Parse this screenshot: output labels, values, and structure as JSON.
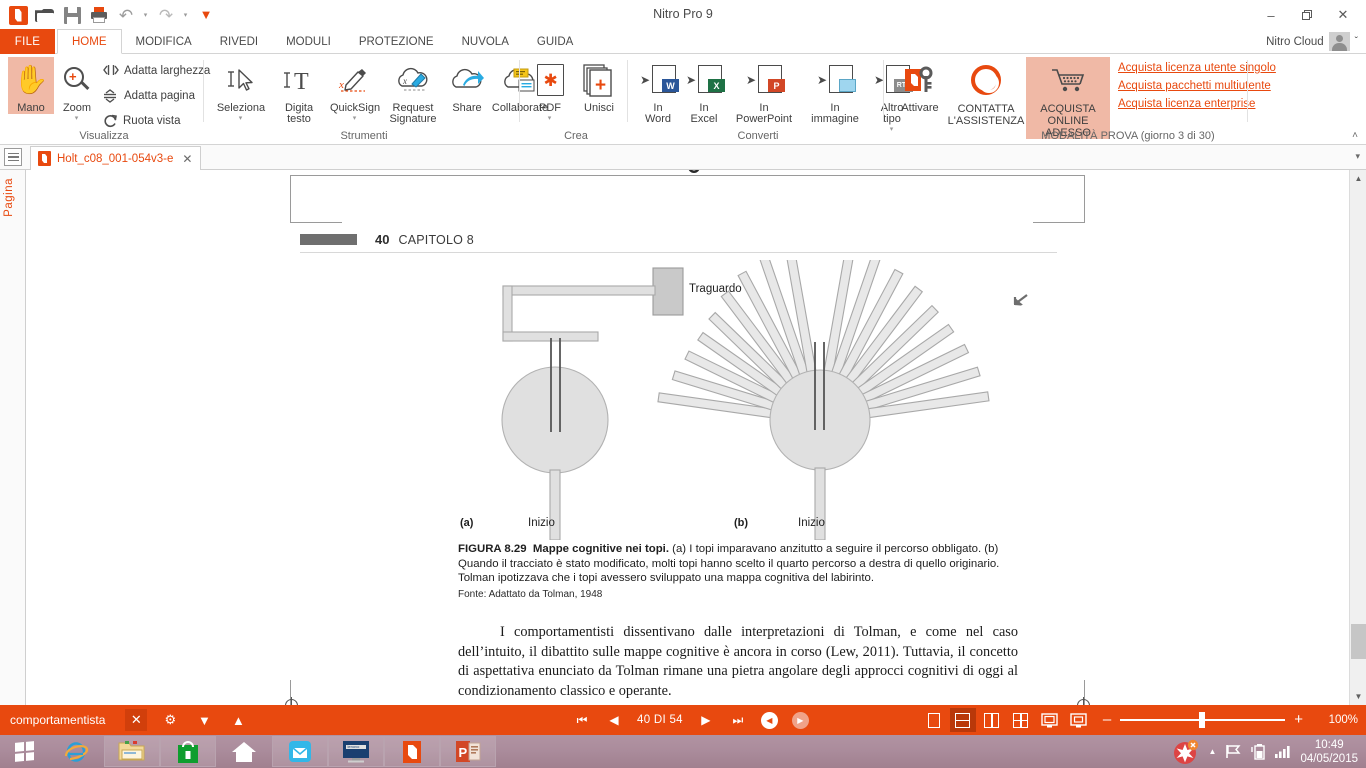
{
  "window": {
    "title": "Nitro Pro 9",
    "minimize": "–",
    "restore": "❐",
    "close": "✕"
  },
  "quick_access": {
    "items": [
      {
        "name": "nitro-app-icon",
        "label": "Nitro"
      },
      {
        "name": "open-icon",
        "label": "Apri"
      },
      {
        "name": "save-icon",
        "label": "Salva"
      },
      {
        "name": "print-icon",
        "label": "Stampa"
      },
      {
        "name": "undo-icon",
        "label": "Annulla"
      },
      {
        "name": "redo-icon",
        "label": "Ripristina"
      },
      {
        "name": "customize-qat-icon",
        "label": "Altro"
      }
    ]
  },
  "ribbon_tabs": {
    "file": "FILE",
    "items": [
      "HOME",
      "MODIFICA",
      "RIVEDI",
      "MODULI",
      "PROTEZIONE",
      "NUVOLA",
      "GUIDA"
    ],
    "active": "HOME"
  },
  "account": {
    "label": "Nitro Cloud",
    "chevron": "ˇ"
  },
  "ribbon": {
    "groups": [
      {
        "name": "visualizza",
        "label": "Visualizza",
        "buttons": [
          {
            "label": "Mano",
            "icon": "hand-icon",
            "active": true
          },
          {
            "label": "Zoom",
            "icon": "zoom-icon",
            "caret": "▾"
          }
        ],
        "small_items": [
          {
            "label": "Adatta larghezza",
            "icon": "fit-width-icon"
          },
          {
            "label": "Adatta pagina",
            "icon": "fit-page-icon"
          },
          {
            "label": "Ruota vista",
            "icon": "rotate-view-icon"
          }
        ]
      },
      {
        "name": "strumenti",
        "label": "Strumenti",
        "buttons": [
          {
            "label": "Seleziona",
            "icon": "select-tool-icon",
            "caret": "▾"
          },
          {
            "label": "Digita testo",
            "icon": "type-text-icon"
          },
          {
            "label": "QuickSign",
            "icon": "quicksign-icon",
            "caret": "▾"
          },
          {
            "label": "Request Signature",
            "icon": "request-signature-icon"
          },
          {
            "label": "Share",
            "icon": "share-icon"
          },
          {
            "label": "Collaborate",
            "icon": "collaborate-icon"
          }
        ]
      },
      {
        "name": "crea",
        "label": "Crea",
        "buttons": [
          {
            "label": "PDF",
            "icon": "create-pdf-icon",
            "caret": "▾"
          },
          {
            "label": "Unisci",
            "icon": "combine-icon"
          }
        ]
      },
      {
        "name": "converti",
        "label": "Converti",
        "buttons": [
          {
            "label": "In Word",
            "icon": "to-word-icon",
            "badge": "W",
            "badge_color": "#2a5699"
          },
          {
            "label": "In Excel",
            "icon": "to-excel-icon",
            "badge": "X",
            "badge_color": "#1e7145"
          },
          {
            "label": "In PowerPoint",
            "icon": "to-powerpoint-icon",
            "badge": "P",
            "badge_color": "#d24726"
          },
          {
            "label": "In immagine",
            "icon": "to-image-icon",
            "badge": "",
            "badge_color": "#7ec8e3"
          },
          {
            "label": "Altro tipo",
            "icon": "to-other-icon",
            "badge": "RTF",
            "badge_color": "#8c8c8c",
            "caret": "▾"
          }
        ]
      },
      {
        "name": "licenza",
        "label": "MODALITÀ PROVA (giorno 3 di 30)",
        "buttons": [
          {
            "label": "Attivare",
            "icon": "activate-key-icon"
          },
          {
            "label": "CONTATTA L'ASSISTENZA",
            "icon": "support-lifering-icon"
          },
          {
            "label": "ACQUISTA ONLINE ADESSO",
            "icon": "shopping-cart-icon",
            "highlight": true
          }
        ],
        "links": [
          "Acquista licenza utente singolo",
          "Acquista pacchetti multiutente",
          "Acquista licenza enterprise"
        ],
        "collapse": "˄"
      }
    ]
  },
  "document_tabs": {
    "panel_toggle": "side-panel-toggle",
    "tabs": [
      {
        "name": "Holt_c08_001-054v3-e",
        "close": "✕"
      }
    ],
    "overflow": "▾"
  },
  "left_rail": {
    "label": "Pagina"
  },
  "document": {
    "header": {
      "page_number": "40",
      "chapter": "CAPITOLO 8"
    },
    "figure": {
      "goal_label": "Traguardo",
      "start_label_a": "Inizio",
      "start_label_b": "Inizio",
      "panel_a": "(a)",
      "panel_b": "(b)"
    },
    "caption_title": "FIGURA 8.29",
    "caption_bold": "Mappe cognitive nei topi.",
    "caption_text": " (a) I topi imparavano anzitutto a seguire il percorso obbligato. (b) Quando il tracciato è stato modificato, molti topi hanno scelto il quarto percorso a destra di quello originario. Tolman ipotizzava che i topi avessero sviluppato una mappa cognitiva del labirinto.",
    "caption_source": "Fonte: Adattato da Tolman, 1948",
    "body_text": "I comportamentisti dissentivano dalle interpretazioni di Tolman, e come nel caso dell’intuito, il dibattito sulle mappe cognitive è ancora in corso (Lew, 2011). Tuttavia, il concetto di aspettativa enunciato da Tolman rimane una pietra angolare degli approcci cognitivi di oggi al condizionamento classico e operante."
  },
  "status_bar": {
    "find_term": "comportamentista",
    "find_buttons": [
      {
        "name": "close-find-icon",
        "glyph": "✕",
        "active": true
      },
      {
        "name": "find-settings-icon",
        "glyph": "⚙"
      },
      {
        "name": "find-next-icon",
        "glyph": "▼"
      },
      {
        "name": "find-prev-icon",
        "glyph": "▲"
      }
    ],
    "page_nav": {
      "first": "⏮",
      "prev": "◀",
      "counter": "40 DI 54",
      "next": "▶",
      "last": "⏭",
      "back": "◀",
      "forward": "▶"
    },
    "view_modes": [
      {
        "name": "single-page-view",
        "active": false
      },
      {
        "name": "continuous-view",
        "active": true
      },
      {
        "name": "two-page-view",
        "active": false
      },
      {
        "name": "grid-view",
        "active": false
      },
      {
        "name": "fit-screen-view",
        "active": false
      },
      {
        "name": "presentation-view",
        "active": false
      }
    ],
    "zoom": {
      "minus": "–",
      "plus": "+",
      "level": "100%"
    }
  },
  "taskbar": {
    "start": "start-button",
    "items": [
      {
        "name": "internet-explorer-icon"
      },
      {
        "name": "file-explorer-icon"
      },
      {
        "name": "windows-store-icon"
      },
      {
        "name": "home-icon"
      },
      {
        "name": "mail-icon"
      },
      {
        "name": "lenovo-icon"
      },
      {
        "name": "nitro-pro-icon"
      },
      {
        "name": "powerpoint-icon"
      }
    ],
    "tray": {
      "show_hidden": "▲",
      "icons": [
        "network-flag-icon",
        "battery-icon",
        "signal-icon"
      ],
      "time": "10:49",
      "date": "04/05/2015"
    }
  }
}
